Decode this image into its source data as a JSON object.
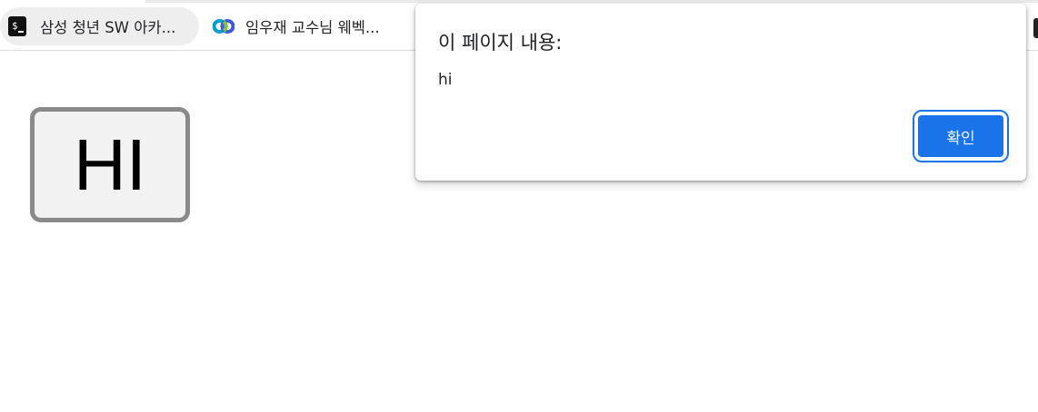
{
  "bookmarks": [
    {
      "label": "삼성 청년 SW 아카...",
      "icon": "terminal-dollar-icon"
    },
    {
      "label": "임우재 교수님 웨벡...",
      "icon": "webex-icon"
    }
  ],
  "page": {
    "hi_button_label": "HI"
  },
  "alert": {
    "title": "이 페이지 내용:",
    "message": "hi",
    "ok_label": "확인"
  },
  "colors": {
    "accent": "#1a73e8",
    "hi_button_border": "#8a8a8a",
    "hi_button_bg": "#f2f2f2"
  }
}
